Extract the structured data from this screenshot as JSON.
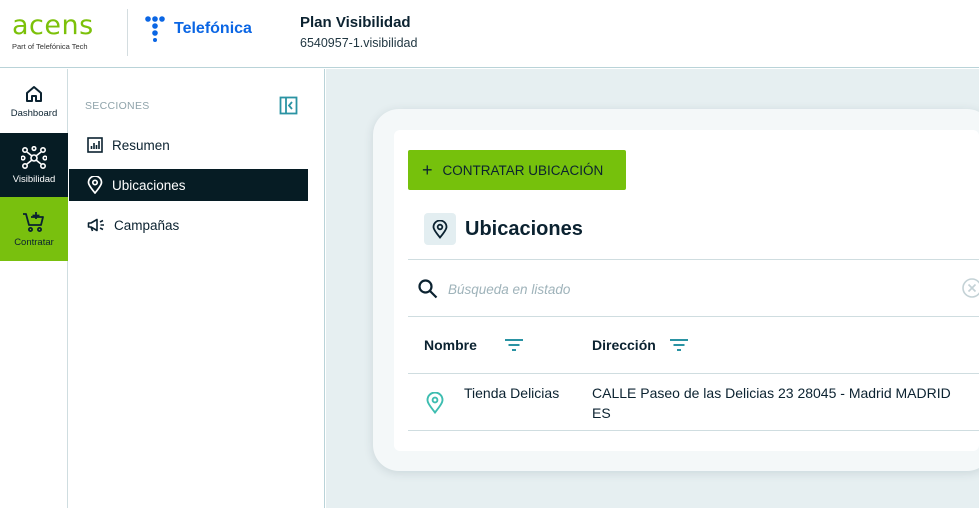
{
  "header": {
    "brand": "acens",
    "brand_sub": "Part of Telefónica Tech",
    "partner": "Telefónica",
    "title": "Plan Visibilidad",
    "subtitle": "6540957-1.visibilidad"
  },
  "rail": {
    "items": [
      {
        "label": "Dashboard",
        "icon": "home-icon"
      },
      {
        "label": "Visibilidad",
        "icon": "network-icon"
      },
      {
        "label": "Contratar",
        "icon": "cart-add-icon"
      }
    ]
  },
  "sections": {
    "title": "SECCIONES",
    "items": [
      {
        "label": "Resumen",
        "icon": "chart-icon"
      },
      {
        "label": "Ubicaciones",
        "icon": "location-pin-icon",
        "active": true
      },
      {
        "label": "Campañas",
        "icon": "megaphone-icon"
      }
    ]
  },
  "main": {
    "add_button": "CONTRATAR UBICACIÓN",
    "heading": "Ubicaciones",
    "search": {
      "placeholder": "Búsqueda en listado",
      "value": ""
    },
    "table": {
      "columns": [
        "Nombre",
        "Dirección"
      ],
      "rows": [
        {
          "name": "Tienda Delicias",
          "address": "CALLE Paseo de las Delicias 23 28045 - Madrid MADRID ES"
        }
      ]
    }
  },
  "colors": {
    "accent_green": "#79c00e",
    "dark_navy": "#061c24",
    "background": "#e6eff1",
    "telefonica_blue": "#0b66e4",
    "pin_teal": "#3dbdb0"
  }
}
